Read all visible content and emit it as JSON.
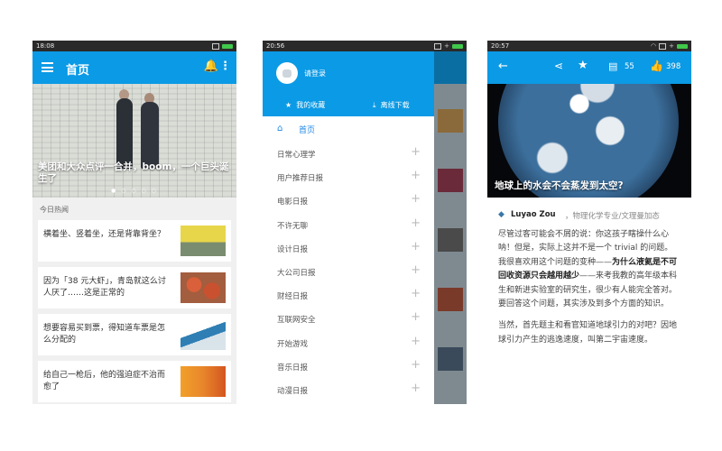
{
  "phone1": {
    "status": {
      "time": "18:08"
    },
    "appbar": {
      "title": "首页"
    },
    "hero": {
      "caption": "美团和大众点评一合并，boom，一个巨头诞生了"
    },
    "section": "今日热闻",
    "stories": [
      {
        "title": "横着坐、竖着坐，还是背靠背坐？"
      },
      {
        "title": "因为「38 元大虾」，青岛就这么讨人厌了……这是正常的"
      },
      {
        "title": "想要容易买到票，得知道车票是怎么分配的"
      },
      {
        "title": "给自己一枪后，他的强迫症不治而愈了"
      }
    ]
  },
  "phone2": {
    "status": {
      "time": "20:56"
    },
    "drawer": {
      "login": "请登录",
      "favorites": "我的收藏",
      "offline": "离线下载",
      "home": "首页",
      "items": [
        "日常心理学",
        "用户推荐日报",
        "电影日报",
        "不许无聊",
        "设计日报",
        "大公司日报",
        "财经日报",
        "互联网安全",
        "开始游戏",
        "音乐日报",
        "动漫日报"
      ]
    }
  },
  "phone3": {
    "status": {
      "time": "20:57"
    },
    "appbar": {
      "comments": "55",
      "likes": "398"
    },
    "hero": {
      "caption": "地球上的水会不会蒸发到太空?"
    },
    "author": {
      "name": "Luyao Zou",
      "role": "，物理化学专业/文理曼加态"
    },
    "para1_a": "尽管过客可能会不屑的说：你这孩子瞎操什么心呐！但是，实际上这并不是一个 trivial 的问题。我很喜欢用这个问题的变种——",
    "para1_b": "为什么液氦是不可回收资源只会越用越少",
    "para1_c": "——来考我教的高年级本科生和新进实验室的研究生，很少有人能完全答对。要回答这个问题，其实涉及到多个方面的知识。",
    "para2": "当然，首先题主和看官知道地球引力的对吧？因地球引力产生的逃逸速度，叫第二宇宙速度。"
  }
}
